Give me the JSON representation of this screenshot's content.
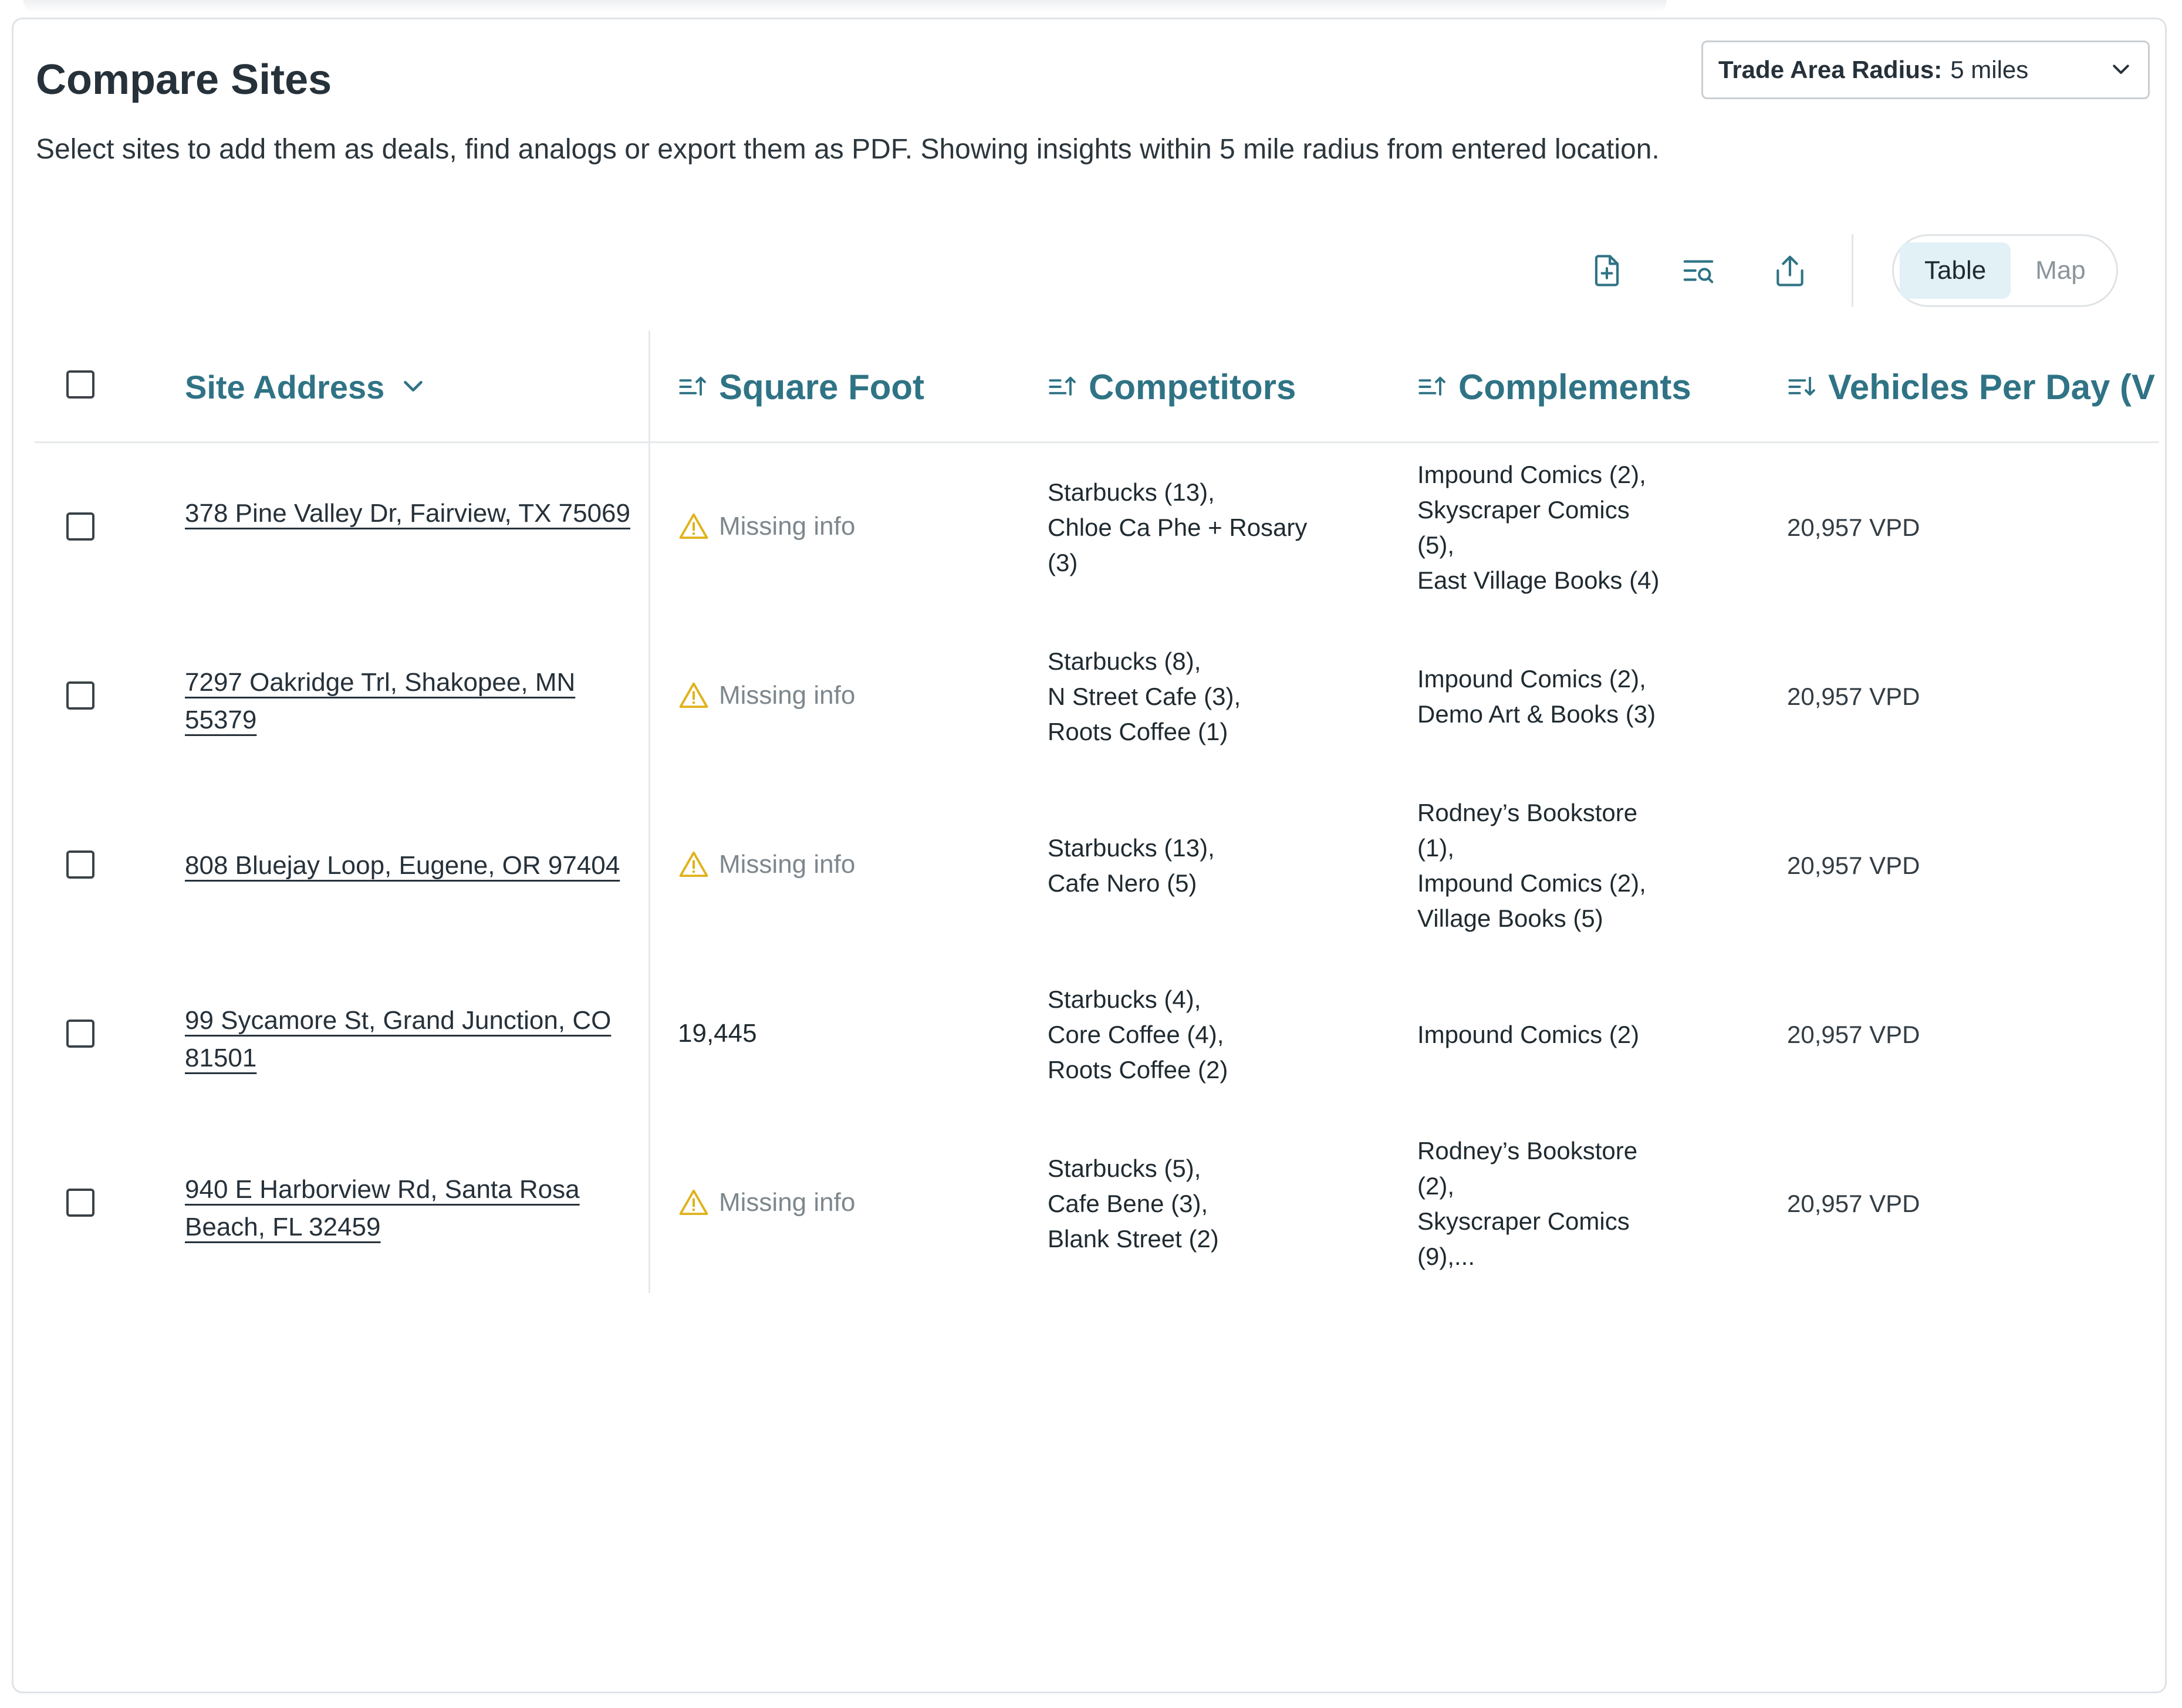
{
  "page": {
    "title": "Compare Sites",
    "subtitle": "Select sites to add them as deals, find analogs or export them as PDF. Showing insights within 5 mile radius from entered location."
  },
  "radius_select": {
    "label": "Trade Area Radius:",
    "value": "5 miles"
  },
  "toolbar": {
    "icons": [
      "add-document-icon",
      "find-analogs-icon",
      "export-icon"
    ]
  },
  "view_toggle": {
    "options": [
      "Table",
      "Map"
    ],
    "active": "Table"
  },
  "table": {
    "headers": {
      "site_address": "Site Address",
      "square_foot": "Square Foot",
      "competitors": "Competitors",
      "complements": "Complements",
      "vehicles": "Vehicles Per Day (V"
    },
    "rows": [
      {
        "address": "378 Pine Valley Dr, Fairview, TX 75069",
        "square_foot": "Missing info",
        "missing": true,
        "competitors": [
          "Starbucks (13),",
          "Chloe Ca Phe + Rosary",
          "(3)"
        ],
        "complements": [
          "Impound Comics (2),",
          "Skyscraper Comics",
          "(5),",
          "East Village Books (4)"
        ],
        "vehicles": "20,957 VPD"
      },
      {
        "address": "7297 Oakridge Trl, Shakopee, MN 55379",
        "square_foot": "Missing info",
        "missing": true,
        "competitors": [
          "Starbucks (8),",
          "N Street Cafe (3),",
          "Roots Coffee (1)"
        ],
        "complements": [
          "Impound Comics (2),",
          "Demo Art & Books (3)"
        ],
        "vehicles": "20,957 VPD"
      },
      {
        "address": "808 Bluejay Loop, Eugene, OR 97404",
        "square_foot": "Missing info",
        "missing": true,
        "competitors": [
          "Starbucks (13),",
          "Cafe Nero (5)"
        ],
        "complements": [
          "Rodney’s Bookstore",
          "(1),",
          "Impound Comics (2),",
          "Village Books (5)"
        ],
        "vehicles": "20,957 VPD"
      },
      {
        "address": "99 Sycamore St, Grand Junction, CO 81501",
        "square_foot": "19,445",
        "missing": false,
        "competitors": [
          "Starbucks (4),",
          "Core Coffee (4),",
          "Roots Coffee (2)"
        ],
        "complements": [
          "Impound Comics (2)"
        ],
        "vehicles": "20,957 VPD"
      },
      {
        "address": "940 E Harborview Rd, Santa Rosa Beach, FL 32459",
        "square_foot": "Missing info",
        "missing": true,
        "competitors": [
          "Starbucks (5),",
          "Cafe Bene (3),",
          "Blank Street (2)"
        ],
        "complements": [
          "Rodney’s Bookstore",
          "(2),",
          "Skyscraper Comics",
          "(9),..."
        ],
        "vehicles": "20,957 VPD"
      }
    ]
  },
  "colors": {
    "header_text": "#2f7385",
    "icon": "#2f7385",
    "warning": "#e0b21a",
    "toggle_active_bg": "#e2f1f6"
  }
}
